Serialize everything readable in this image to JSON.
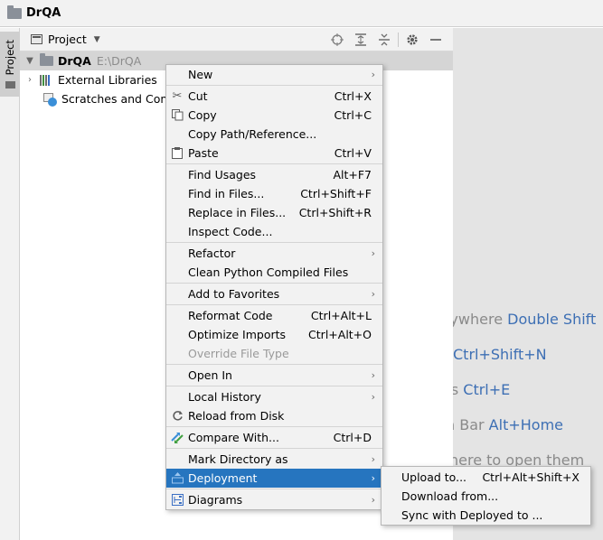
{
  "window": {
    "title": "DrQA"
  },
  "tool_strip": {
    "project_tab": "Project"
  },
  "panel": {
    "view_selector": "Project",
    "tree": [
      {
        "name": "DrQA",
        "path": "E:\\DrQA"
      },
      {
        "name": "External Libraries"
      },
      {
        "name": "Scratches and Conso"
      }
    ]
  },
  "editor_hints": [
    {
      "text": "erywhere ",
      "key": "Double Shift"
    },
    {
      "text": "",
      "key": "Ctrl+Shift+N"
    },
    {
      "text": "es ",
      "key": "Ctrl+E"
    },
    {
      "text": "n Bar ",
      "key": "Alt+Home"
    },
    {
      "text": "here to open them",
      "key": ""
    }
  ],
  "context_menu": {
    "items": [
      {
        "label": "New",
        "shortcut": "",
        "submenu": true
      },
      {
        "label": "Cut",
        "shortcut": "Ctrl+X",
        "icon": "scissors-icon"
      },
      {
        "label": "Copy",
        "shortcut": "Ctrl+C",
        "icon": "copy-icon"
      },
      {
        "label": "Copy Path/Reference...",
        "shortcut": ""
      },
      {
        "label": "Paste",
        "shortcut": "Ctrl+V",
        "icon": "clipboard-icon"
      },
      {
        "label": "Find Usages",
        "shortcut": "Alt+F7"
      },
      {
        "label": "Find in Files...",
        "shortcut": "Ctrl+Shift+F"
      },
      {
        "label": "Replace in Files...",
        "shortcut": "Ctrl+Shift+R"
      },
      {
        "label": "Inspect Code...",
        "shortcut": ""
      },
      {
        "label": "Refactor",
        "shortcut": "",
        "submenu": true
      },
      {
        "label": "Clean Python Compiled Files",
        "shortcut": ""
      },
      {
        "label": "Add to Favorites",
        "shortcut": "",
        "submenu": true
      },
      {
        "label": "Reformat Code",
        "shortcut": "Ctrl+Alt+L"
      },
      {
        "label": "Optimize Imports",
        "shortcut": "Ctrl+Alt+O"
      },
      {
        "label": "Override File Type",
        "shortcut": "",
        "disabled": true
      },
      {
        "label": "Open In",
        "shortcut": "",
        "submenu": true
      },
      {
        "label": "Local History",
        "shortcut": "",
        "submenu": true
      },
      {
        "label": "Reload from Disk",
        "shortcut": "",
        "icon": "reload-icon"
      },
      {
        "label": "Compare With...",
        "shortcut": "Ctrl+D",
        "icon": "compare-icon"
      },
      {
        "label": "Mark Directory as",
        "shortcut": "",
        "submenu": true
      },
      {
        "label": "Deployment",
        "shortcut": "",
        "submenu": true,
        "highlighted": true,
        "icon": "deployment-icon"
      },
      {
        "label": "Diagrams",
        "shortcut": "",
        "submenu": true,
        "icon": "diagram-icon"
      }
    ]
  },
  "deployment_submenu": {
    "items": [
      {
        "label": "Upload to...",
        "shortcut": "Ctrl+Alt+Shift+X"
      },
      {
        "label": "Download from...",
        "shortcut": ""
      },
      {
        "label": "Sync with Deployed to ...",
        "shortcut": ""
      }
    ]
  }
}
